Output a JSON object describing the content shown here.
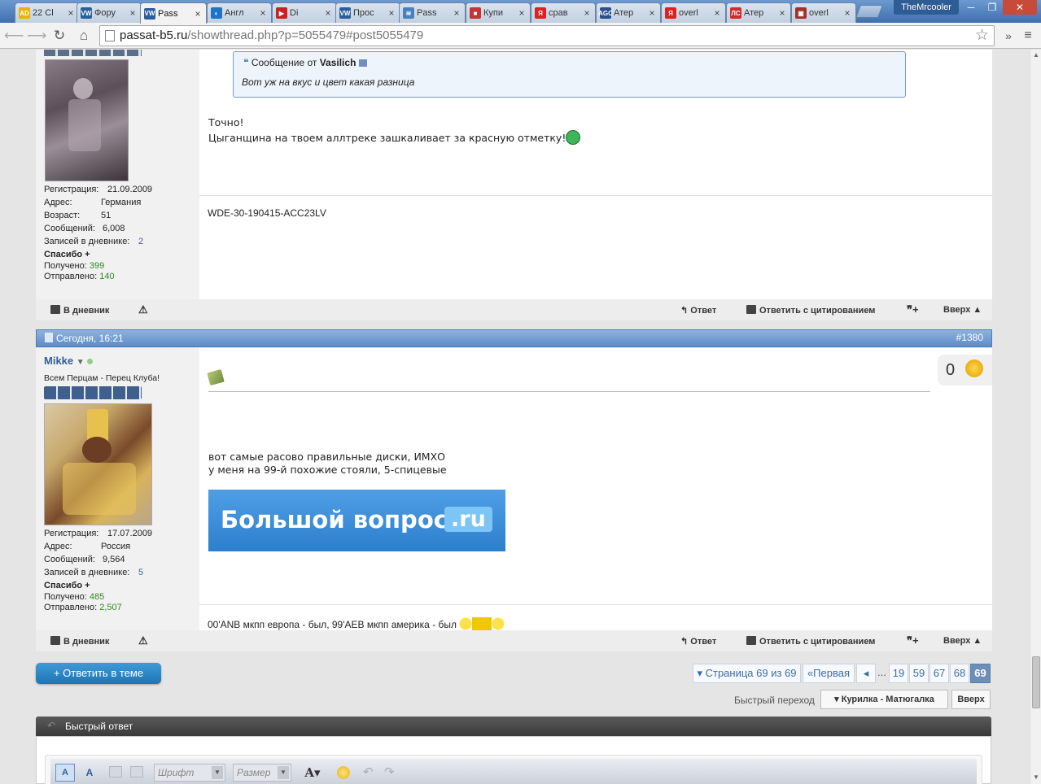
{
  "browser": {
    "tabs": [
      {
        "favicon": "AD",
        "favicon_color": "#e8b400",
        "label": "22 Cl"
      },
      {
        "favicon": "VW",
        "favicon_color": "#2b5e9e",
        "label": "Фору"
      },
      {
        "favicon": "VW",
        "favicon_color": "#2b5e9e",
        "label": "Pass"
      },
      {
        "favicon": "◐",
        "favicon_color": "#1e73c6",
        "label": "Англ"
      },
      {
        "favicon": "▶",
        "favicon_color": "#cc1f1f",
        "label": "Di"
      },
      {
        "favicon": "VW",
        "favicon_color": "#2b5e9e",
        "label": "Прос"
      },
      {
        "favicon": "≋",
        "favicon_color": "#4a7fc0",
        "label": "Pass"
      },
      {
        "favicon": "■",
        "favicon_color": "#c83232",
        "label": "Купи"
      },
      {
        "favicon": "Я",
        "favicon_color": "#e02020",
        "label": "срав"
      },
      {
        "favicon": "AGC",
        "favicon_color": "#2a4f8a",
        "label": "Атер"
      },
      {
        "favicon": "Я",
        "favicon_color": "#e02020",
        "label": "overl"
      },
      {
        "favicon": "ЛС",
        "favicon_color": "#d42a2a",
        "label": "Атер"
      },
      {
        "favicon": "▣",
        "favicon_color": "#a0312a",
        "label": "overl"
      }
    ],
    "user": "TheMrcooler",
    "window_controls": [
      "─",
      "❐",
      "✕"
    ],
    "url_host": "passat-b5.ru",
    "url_path": "/showthread.php?p=5055479#post5055479",
    "menu_chevron": "»",
    "menu_icon": "≡"
  },
  "post_prev": {
    "quote_header": "Сообщение от",
    "quote_author": "Vasilich",
    "quote_text": "Вот уж на вкус и цвет какая разница",
    "message_line1": "Точно!",
    "message_line2": "Цыганщина на твоем аллтреке зашкаливает за красную отметку!",
    "signature": "WDE-30-190415-ACC23LV",
    "user": {
      "reg_label": "Регистрация:",
      "reg": "21.09.2009",
      "addr_label": "Адрес:",
      "addr": "Германия",
      "age_label": "Возраст:",
      "age": "51",
      "msgs_label": "Сообщений:",
      "msgs": "6,008",
      "diary_label": "Записей в дневнике:",
      "diary": "2",
      "thanks": "Спасибо +",
      "received_label": "Получено:",
      "received": "399",
      "sent_label": "Отправлено:",
      "sent": "140"
    }
  },
  "post_footer": {
    "diary": "В дневник",
    "reply": "Ответ",
    "reply_quote": "Ответить с цитированием",
    "top": "Вверх ▲"
  },
  "post_main": {
    "date": "Сегодня, 16:21",
    "number": "#1380",
    "username": "Mikke",
    "user_title": "Всем Перцам - Перец Клуба!",
    "rating": "0",
    "message_line1": "вот самые расово правильные диски, ИМХО",
    "message_line2": "у меня на 99-й похожие стояли, 5-спицевые",
    "banner_text": "Большой вопрос",
    "banner_suffix": ".ru",
    "signature": "00'ANB мкпп европа - был, 99'AEB мкпп америка - был",
    "user": {
      "reg_label": "Регистрация:",
      "reg": "17.07.2009",
      "addr_label": "Адрес:",
      "addr": "Россия",
      "msgs_label": "Сообщений:",
      "msgs": "9,564",
      "diary_label": "Записей в дневнике:",
      "diary": "5",
      "thanks": "Спасибо +",
      "received_label": "Получено:",
      "received": "485",
      "sent_label": "Отправлено:",
      "sent": "2,507"
    }
  },
  "reply_button": "+ Ответить в теме",
  "pagination": {
    "summary": "▾ Страница 69 из 69",
    "first": "«Первая",
    "prev": "◂",
    "ellipsis": "...",
    "pages": [
      "19",
      "59",
      "67",
      "68",
      "69"
    ],
    "current": "69"
  },
  "quick_jump": {
    "label": "Быстрый переход",
    "selected": "▾ Курилка - Матюгалка",
    "go": "Вверх"
  },
  "quick_reply": {
    "title": "Быстрый ответ",
    "font_placeholder": "Шрифт",
    "size_placeholder": "Размер"
  }
}
